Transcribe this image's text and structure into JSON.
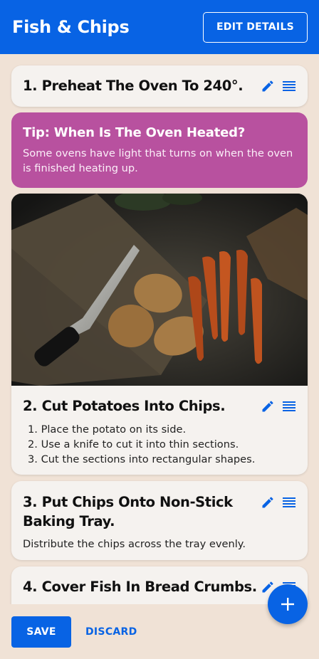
{
  "app_bar": {
    "title": "Fish & Chips",
    "edit_label": "EDIT DETAILS",
    "background": "#0863e4"
  },
  "steps": [
    {
      "title": "1. Preheat The Oven To 240°."
    },
    {
      "tip_title": "Tip: When Is The Oven Heated?",
      "tip_text": "Some ovens have light that turns on when the oven is finished heating up.",
      "tip_color": "#b8519f"
    },
    {
      "image": "photo-knife-potatoes-carrots",
      "title": "2. Cut Potatoes Into Chips.",
      "list": [
        "1. Place the potato on its side.",
        "2. Use a knife to cut it into thin sections.",
        "3. Cut the sections into rectangular shapes."
      ]
    },
    {
      "title": "3. Put Chips Onto Non-Stick Baking Tray.",
      "text": "Distribute the chips across the tray evenly."
    },
    {
      "title": "4. Cover Fish In Bread Crumbs."
    }
  ],
  "icons": {
    "edit": "pencil-icon",
    "drag": "drag-handle-icon",
    "add": "plus-icon"
  },
  "bottom_bar": {
    "save_label": "SAVE",
    "discard_label": "DISCARD"
  }
}
